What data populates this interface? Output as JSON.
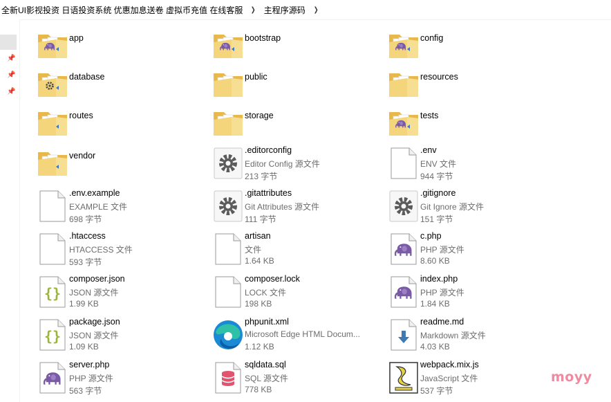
{
  "breadcrumbs": [
    "全新UI影视投资 日语投资系统 优惠加息送卷 虚拟币充值 在线客服",
    "主程序源码"
  ],
  "folders": [
    {
      "name": "app",
      "badge": "php"
    },
    {
      "name": "bootstrap",
      "badge": "php"
    },
    {
      "name": "config",
      "badge": "php"
    },
    {
      "name": "database",
      "badge": "gear"
    },
    {
      "name": "public",
      "badge": "none"
    },
    {
      "name": "resources",
      "badge": "none"
    },
    {
      "name": "routes",
      "badge": "blue"
    },
    {
      "name": "storage",
      "badge": "none"
    },
    {
      "name": "tests",
      "badge": "php"
    },
    {
      "name": "vendor",
      "badge": "blue"
    }
  ],
  "files": [
    {
      "name": ".editorconfig",
      "type": "Editor Config 源文件",
      "size": "213 字节",
      "icon": "gear"
    },
    {
      "name": ".env",
      "type": "ENV 文件",
      "size": "944 字节",
      "icon": "blank"
    },
    {
      "name": ".env.example",
      "type": "EXAMPLE 文件",
      "size": "698 字节",
      "icon": "blank"
    },
    {
      "name": ".gitattributes",
      "type": "Git Attributes 源文件",
      "size": "111 字节",
      "icon": "gear"
    },
    {
      "name": ".gitignore",
      "type": "Git Ignore 源文件",
      "size": "151 字节",
      "icon": "gear"
    },
    {
      "name": ".htaccess",
      "type": "HTACCESS 文件",
      "size": "593 字节",
      "icon": "blank"
    },
    {
      "name": "artisan",
      "type": "文件",
      "size": "1.64 KB",
      "icon": "blank"
    },
    {
      "name": "c.php",
      "type": "PHP 源文件",
      "size": "8.60 KB",
      "icon": "php"
    },
    {
      "name": "composer.json",
      "type": "JSON 源文件",
      "size": "1.99 KB",
      "icon": "json"
    },
    {
      "name": "composer.lock",
      "type": "LOCK 文件",
      "size": "198 KB",
      "icon": "blank"
    },
    {
      "name": "index.php",
      "type": "PHP 源文件",
      "size": "1.84 KB",
      "icon": "php"
    },
    {
      "name": "package.json",
      "type": "JSON 源文件",
      "size": "1.09 KB",
      "icon": "json"
    },
    {
      "name": "phpunit.xml",
      "type": "Microsoft Edge HTML Docum...",
      "size": "1.12 KB",
      "icon": "edge"
    },
    {
      "name": "readme.md",
      "type": "Markdown 源文件",
      "size": "4.03 KB",
      "icon": "md"
    },
    {
      "name": "server.php",
      "type": "PHP 源文件",
      "size": "563 字节",
      "icon": "php"
    },
    {
      "name": "sqldata.sql",
      "type": "SQL 源文件",
      "size": "778 KB",
      "icon": "sql"
    },
    {
      "name": "webpack.mix.js",
      "type": "JavaScript 文件",
      "size": "537 字节",
      "icon": "js"
    }
  ],
  "watermark": "moyy"
}
